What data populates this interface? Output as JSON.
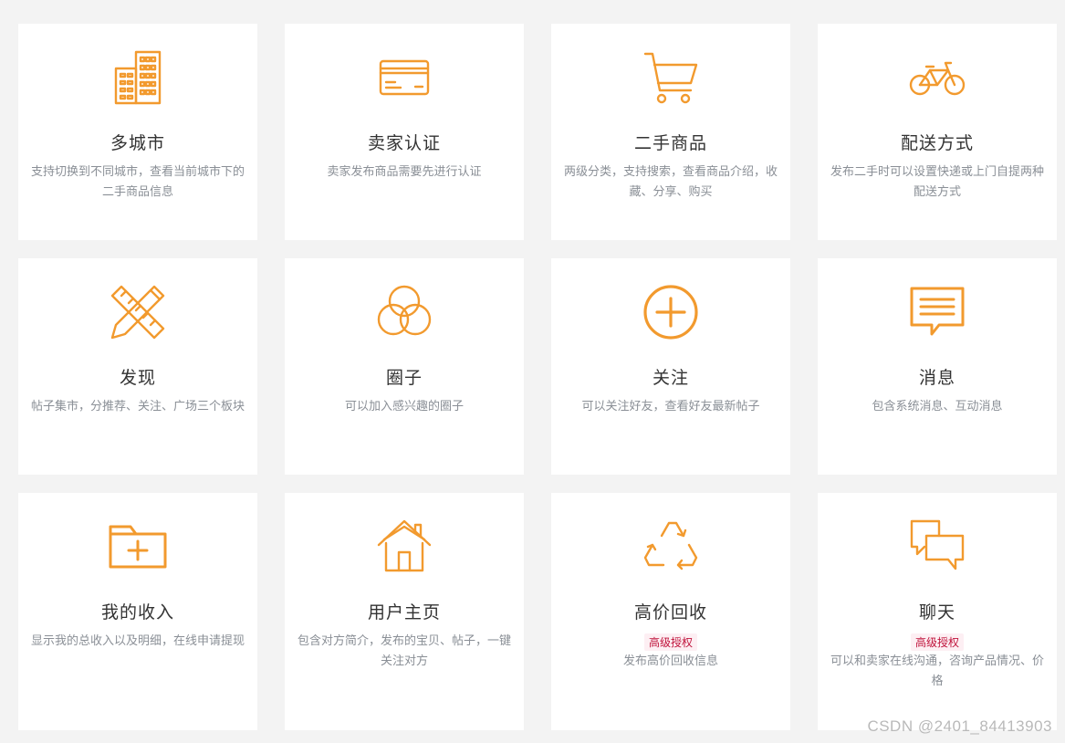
{
  "accent_color": "#f29a2e",
  "badge_color": "#c0143c",
  "cards": [
    {
      "icon": "building-icon",
      "title": "多城市",
      "desc": "支持切换到不同城市，查看当前城市下的二手商品信息"
    },
    {
      "icon": "credit-card-icon",
      "title": "卖家认证",
      "desc": "卖家发布商品需要先进行认证"
    },
    {
      "icon": "shopping-cart-icon",
      "title": "二手商品",
      "desc": "两级分类，支持搜索，查看商品介绍，收藏、分享、购买"
    },
    {
      "icon": "bicycle-icon",
      "title": "配送方式",
      "desc": "发布二手时可以设置快递或上门自提两种配送方式"
    },
    {
      "icon": "ruler-pencil-icon",
      "title": "发现",
      "desc": "帖子集市，分推荐、关注、广场三个板块"
    },
    {
      "icon": "circles-icon",
      "title": "圈子",
      "desc": "可以加入感兴趣的圈子"
    },
    {
      "icon": "plus-circle-icon",
      "title": "关注",
      "desc": "可以关注好友，查看好友最新帖子"
    },
    {
      "icon": "message-icon",
      "title": "消息",
      "desc": "包含系统消息、互动消息"
    },
    {
      "icon": "folder-plus-icon",
      "title": "我的收入",
      "desc": "显示我的总收入以及明细，在线申请提现"
    },
    {
      "icon": "home-icon",
      "title": "用户主页",
      "desc": "包含对方简介，发布的宝贝、帖子，一键关注对方"
    },
    {
      "icon": "recycle-icon",
      "title": "高价回收",
      "badge": "高级授权",
      "desc": "发布高价回收信息"
    },
    {
      "icon": "chat-bubbles-icon",
      "title": "聊天",
      "badge": "高级授权",
      "desc": "可以和卖家在线沟通，咨询产品情况、价格"
    }
  ],
  "watermark": "CSDN @2401_84413903"
}
